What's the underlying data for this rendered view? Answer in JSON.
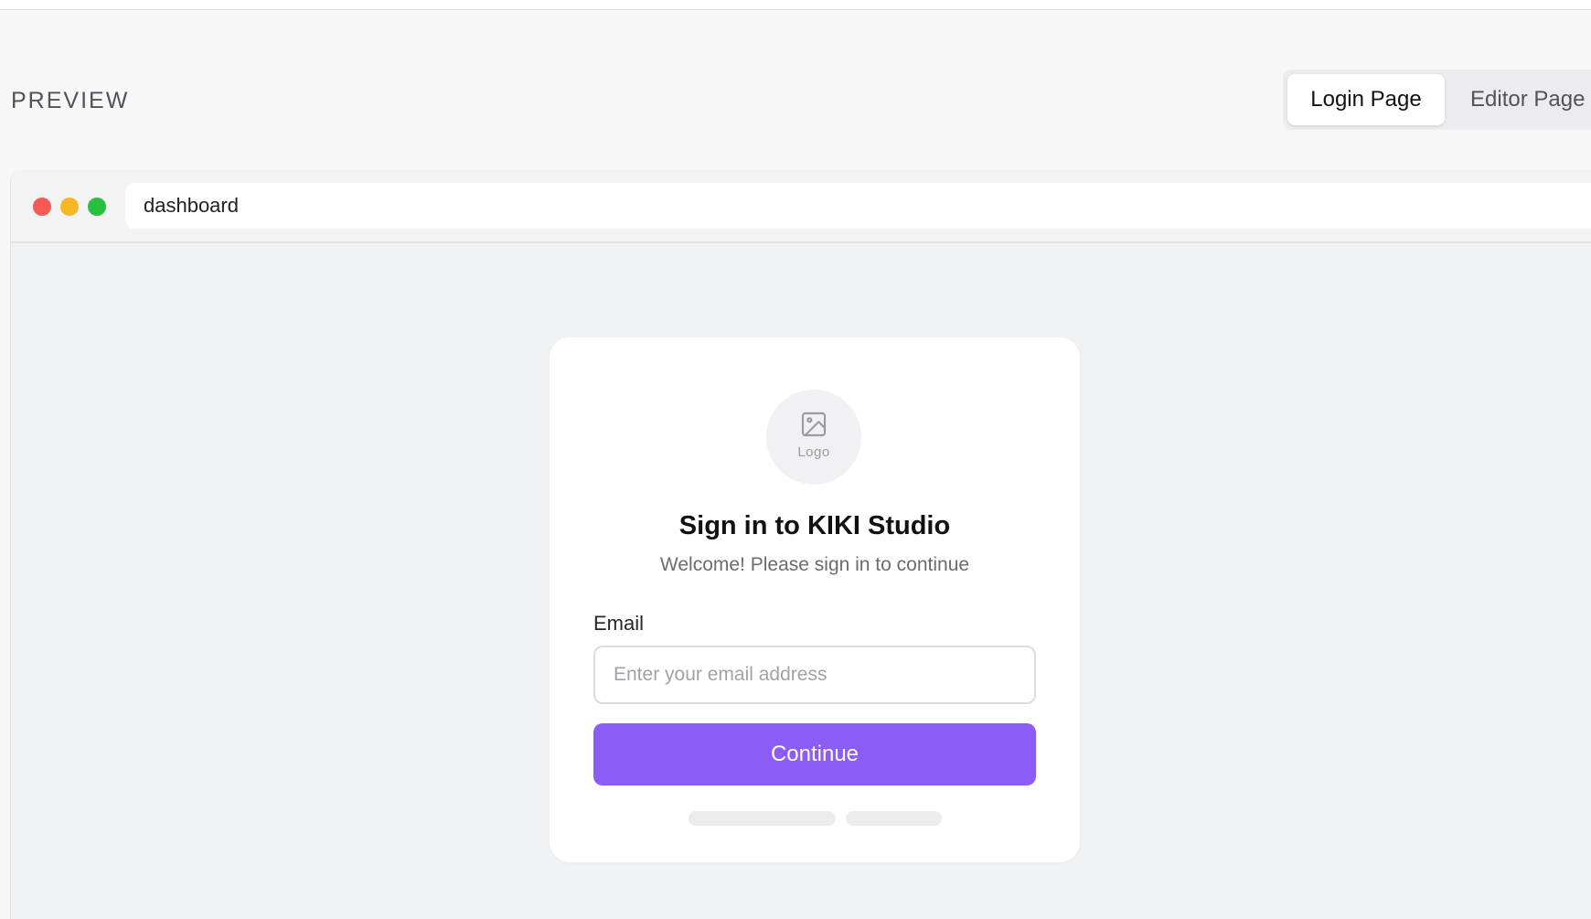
{
  "preview": {
    "label": "PREVIEW"
  },
  "tabs": [
    {
      "label": "Login Page",
      "active": true
    },
    {
      "label": "Editor Page",
      "active": false
    }
  ],
  "browser": {
    "address": "dashboard",
    "controls": [
      "close",
      "minimize",
      "maximize"
    ],
    "control_colors": {
      "close": "#f25a53",
      "minimize": "#f8b729",
      "maximize": "#27c13f"
    }
  },
  "login": {
    "logo_text": "Logo",
    "logo_icon": "image-icon",
    "title": "Sign in to KIKI Studio",
    "subtitle": "Welcome! Please sign in to continue",
    "email_label": "Email",
    "email_placeholder": "Enter your email address",
    "email_value": "",
    "continue_label": "Continue"
  },
  "colors": {
    "accent": "#8b5cf6",
    "background": "#f7f7f8",
    "card": "#ffffff"
  }
}
